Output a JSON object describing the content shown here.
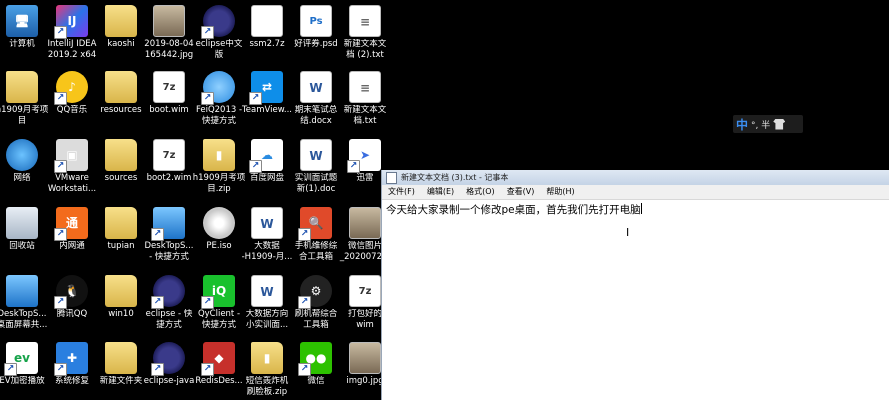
{
  "desktop_icons": [
    {
      "label": "计算机",
      "icon": "computer-icon"
    },
    {
      "label": "IntelliJ IDEA\n2019.2 x64",
      "icon": "intellij-icon"
    },
    {
      "label": "kaoshi",
      "icon": "folder-icon"
    },
    {
      "label": "2019-08-04\n165442.jpg",
      "icon": "image-file-icon"
    },
    {
      "label": "eclipse中文\n版",
      "icon": "eclipse-icon"
    },
    {
      "label": "ssm2.7z",
      "icon": "blank-file-icon"
    },
    {
      "label": "好评券.psd",
      "icon": "psd-file-icon"
    },
    {
      "label": "新建文本文\n档 (2).txt",
      "icon": "text-file-icon"
    },
    {
      "label": "h1909月考项\n目",
      "icon": "folder-icon"
    },
    {
      "label": "QQ音乐",
      "icon": "qq-music-icon"
    },
    {
      "label": "resources",
      "icon": "folder-icon"
    },
    {
      "label": "boot.wim",
      "icon": "7z-file-icon"
    },
    {
      "label": "FeiQ2013 -\n快捷方式",
      "icon": "feiq-icon"
    },
    {
      "label": "TeamView...",
      "icon": "teamviewer-icon"
    },
    {
      "label": "期末笔试总\n结.docx",
      "icon": "word-doc-icon"
    },
    {
      "label": "新建文本文\n档.txt",
      "icon": "text-file-icon"
    },
    {
      "label": "网络",
      "icon": "network-icon"
    },
    {
      "label": "VMware\nWorkstati...",
      "icon": "vmware-icon"
    },
    {
      "label": "sources",
      "icon": "folder-icon"
    },
    {
      "label": "boot2.wim",
      "icon": "7z-file-icon"
    },
    {
      "label": "h1909月考项\n目.zip",
      "icon": "zip-folder-icon"
    },
    {
      "label": "百度网盘",
      "icon": "baidu-netdisk-icon"
    },
    {
      "label": "实训面试题\n新(1).doc",
      "icon": "word-doc-icon"
    },
    {
      "label": "迅雷",
      "icon": "xunlei-icon"
    },
    {
      "label": "回收站",
      "icon": "recycle-bin-icon"
    },
    {
      "label": "内网通",
      "icon": "neiwangtong-icon"
    },
    {
      "label": "tupian",
      "icon": "folder-icon"
    },
    {
      "label": "DeskTopS...\n- 快捷方式",
      "icon": "monitor-icon"
    },
    {
      "label": "PE.iso",
      "icon": "iso-file-icon"
    },
    {
      "label": "大数据\n-H1909-月...",
      "icon": "word-doc-icon"
    },
    {
      "label": "手机维修综\n合工具箱",
      "icon": "toolbox-icon"
    },
    {
      "label": "微信图片\n_2020072...",
      "icon": "image-file-icon"
    },
    {
      "label": "DeskTopS...\n桌面屏幕共...",
      "icon": "monitor-icon"
    },
    {
      "label": "腾讯QQ",
      "icon": "qq-icon"
    },
    {
      "label": "win10",
      "icon": "folder-icon"
    },
    {
      "label": "eclipse - 快\n捷方式",
      "icon": "eclipse-icon"
    },
    {
      "label": "QyClient -\n快捷方式",
      "icon": "iqiyi-icon"
    },
    {
      "label": "大数据方向\n小实训面...",
      "icon": "word-doc-icon"
    },
    {
      "label": "刷机帮综合\n工具箱",
      "icon": "flash-tool-icon"
    },
    {
      "label": "打包好的\nwim",
      "icon": "7z-file-icon"
    },
    {
      "label": "EV加密播放",
      "icon": "ev-player-icon"
    },
    {
      "label": "系统修复",
      "icon": "system-repair-icon"
    },
    {
      "label": "新建文件夹",
      "icon": "folder-icon"
    },
    {
      "label": "eclipse-java",
      "icon": "eclipse-icon"
    },
    {
      "label": "RedisDes...",
      "icon": "redis-icon"
    },
    {
      "label": "短信轰炸机\n刷脸板.zip",
      "icon": "zip-folder-icon"
    },
    {
      "label": "微信",
      "icon": "wechat-icon"
    },
    {
      "label": "img0.jpg",
      "icon": "image-file-icon"
    }
  ],
  "notepad": {
    "title": "新建文本文档 (3).txt - 记事本",
    "menu": [
      "文件(F)",
      "编辑(E)",
      "格式(O)",
      "查看(V)",
      "帮助(H)"
    ],
    "content": "今天给大家录制一个修改pe桌面，首先我们先打开电脑"
  },
  "ime": {
    "lang": "中",
    "symbols": "°, 半"
  }
}
